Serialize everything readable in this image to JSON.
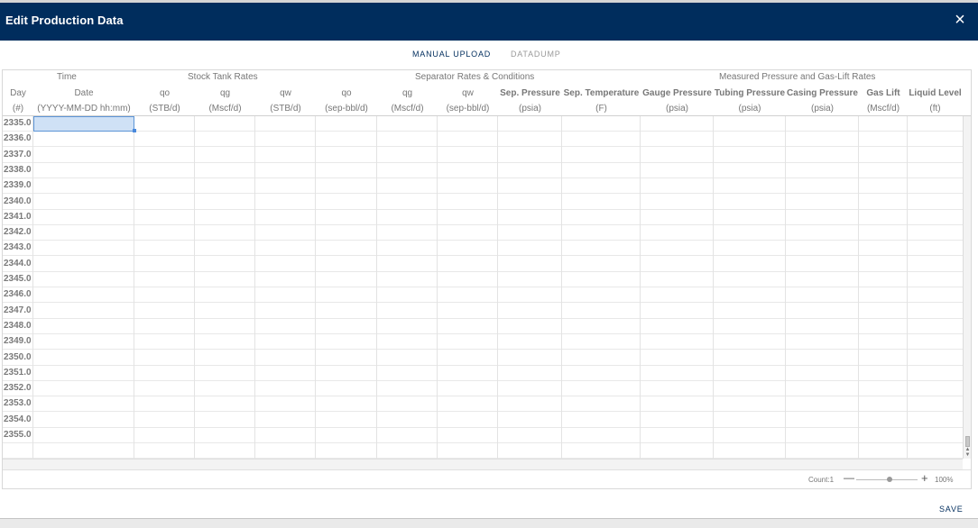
{
  "dialog": {
    "title": "Edit Production Data",
    "close_label": "×",
    "close_icon": "close-icon"
  },
  "tabs": [
    {
      "label": "MANUAL UPLOAD",
      "active": true
    },
    {
      "label": "DATADUMP",
      "active": false
    }
  ],
  "grid": {
    "groups": {
      "time": "Time",
      "stock": "Stock Tank Rates",
      "separator": "Separator Rates & Conditions",
      "measured": "Measured Pressure and Gas-Lift Rates"
    },
    "columns": [
      {
        "name": "Day",
        "unit": "(#)"
      },
      {
        "name": "Date",
        "unit": "(YYYY-MM-DD hh:mm)"
      },
      {
        "name": "qo",
        "unit": "(STB/d)"
      },
      {
        "name": "qg",
        "unit": "(Mscf/d)"
      },
      {
        "name": "qw",
        "unit": "(STB/d)"
      },
      {
        "name": "qo",
        "unit": "(sep-bbl/d)"
      },
      {
        "name": "qg",
        "unit": "(Mscf/d)"
      },
      {
        "name": "qw",
        "unit": "(sep-bbl/d)"
      },
      {
        "name": "Sep. Pressure",
        "unit": "(psia)"
      },
      {
        "name": "Sep. Temperature",
        "unit": "(F)"
      },
      {
        "name": "Gauge Pressure",
        "unit": "(psia)"
      },
      {
        "name": "Tubing Pressure",
        "unit": "(psia)"
      },
      {
        "name": "Casing Pressure",
        "unit": "(psia)"
      },
      {
        "name": "Gas Lift",
        "unit": "(Mscf/d)"
      },
      {
        "name": "Liquid Level",
        "unit": "(ft)"
      }
    ],
    "rows": [
      "2335.0",
      "2336.0",
      "2337.0",
      "2338.0",
      "2339.0",
      "2340.0",
      "2341.0",
      "2342.0",
      "2343.0",
      "2344.0",
      "2345.0",
      "2346.0",
      "2347.0",
      "2348.0",
      "2349.0",
      "2350.0",
      "2351.0",
      "2352.0",
      "2353.0",
      "2354.0",
      "2355.0"
    ]
  },
  "status": {
    "count": "Count:1",
    "zoom_minus": "—",
    "zoom_plus": "+",
    "zoom_level": "100%",
    "zoom_fraction": 0.55
  },
  "actions": {
    "save_label": "SAVE"
  },
  "colors": {
    "titlebar": "#002d5d",
    "selection": "#cfe1f6",
    "selection_border": "#5d95d6"
  }
}
